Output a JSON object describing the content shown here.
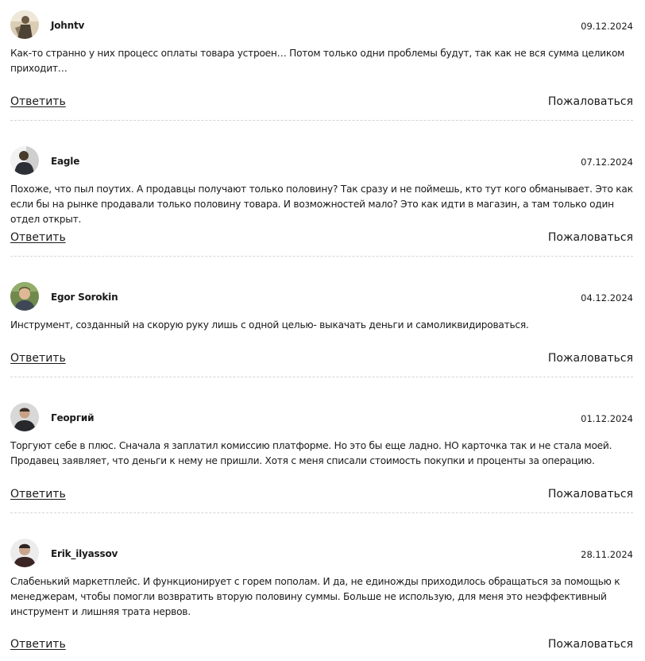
{
  "actions": {
    "reply_label": "Ответить",
    "report_label": "Пожаловаться"
  },
  "comments": [
    {
      "author": "Johntv",
      "date": "09.12.2024",
      "text": "Как-то странно у них процесс оплаты товара устроен… Потом только одни проблемы будут, так как не вся сумма целиком приходит…"
    },
    {
      "author": "Eagle",
      "date": "07.12.2024",
      "text": "Похоже, что пыл поутих. А продавцы получают только половину? Так сразу и не поймешь, кто тут кого обманывает. Это как если бы на рынке продавали только половину товара. И возможностей мало? Это как идти в магазин, а там только один отдел открыт."
    },
    {
      "author": "Egor Sorokin",
      "date": "04.12.2024",
      "text": "Инструмент, созданный на скорую руку лишь с одной целью- выкачать деньги и самоликвидироваться."
    },
    {
      "author": "Георгий",
      "date": "01.12.2024",
      "text": "Торгуют себе в плюс. Сначала я заплатил комиссию платформе. Но это бы еще ладно. НО карточка так и не стала моей. Продавец заявляет, что деньги к нему не пришли. Хотя с меня списали стоимость покупки и проценты за операцию."
    },
    {
      "author": "Erik_ilyassov",
      "date": "28.11.2024",
      "text": "Слабенький маркетплейс. И функционирует с горем пополам. И да, не единожды приходилось обращаться за помощью к менеджерам, чтобы помогли возвратить вторую половину суммы. Больше не использую, для меня это неэффективный инструмент и лишняя трата нервов."
    }
  ]
}
